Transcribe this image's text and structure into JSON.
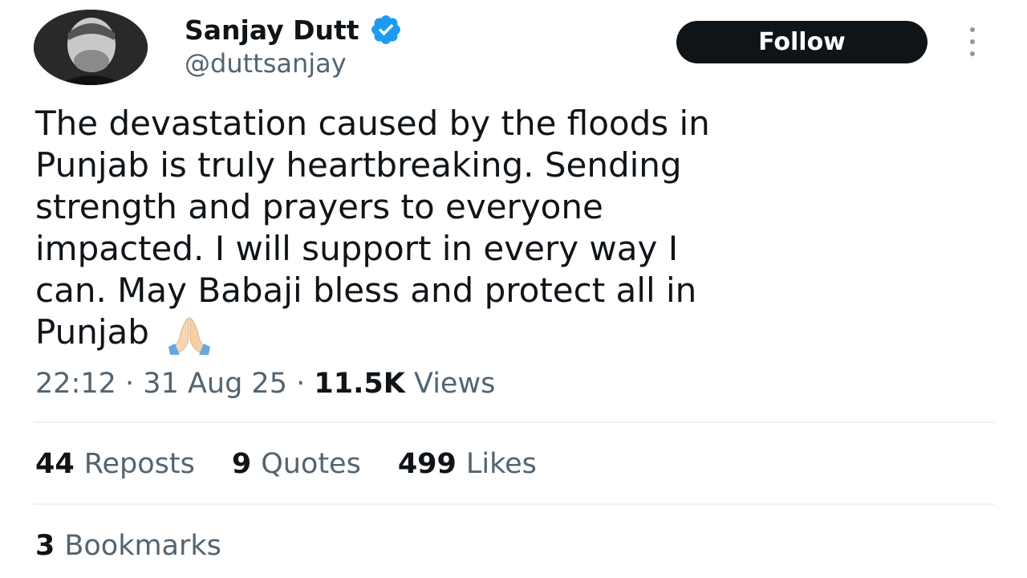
{
  "author": {
    "display_name": "Sanjay Dutt",
    "handle": "@duttsanjay",
    "verified_icon": "verified-badge-icon",
    "verified_color": "#1d9bf0",
    "avatar_icon": "profile-photo"
  },
  "follow_button": {
    "label": "Follow"
  },
  "more_menu": {
    "icon": "more-vertical-icon"
  },
  "tweet": {
    "lines": [
      "The devastation caused by the floods in",
      "Punjab is truly heartbreaking. Sending",
      "strength and prayers to everyone",
      "impacted. I will support in every way I",
      "can. May Babaji bless and protect all in",
      "Punjab"
    ],
    "emoji": "folded-hands-icon"
  },
  "meta": {
    "time": "22:12",
    "separator": "·",
    "date": "31 Aug 25",
    "views_count": "11.5K",
    "views_label": "Views"
  },
  "stats": {
    "reposts": {
      "count": "44",
      "label": "Reposts"
    },
    "quotes": {
      "count": "9",
      "label": "Quotes"
    },
    "likes": {
      "count": "499",
      "label": "Likes"
    },
    "bookmarks": {
      "count": "3",
      "label": "Bookmarks"
    }
  },
  "colors": {
    "text_primary": "#0f1419",
    "text_secondary": "#536471",
    "follow_bg": "#0f1419",
    "divider": "#eff3f4"
  }
}
